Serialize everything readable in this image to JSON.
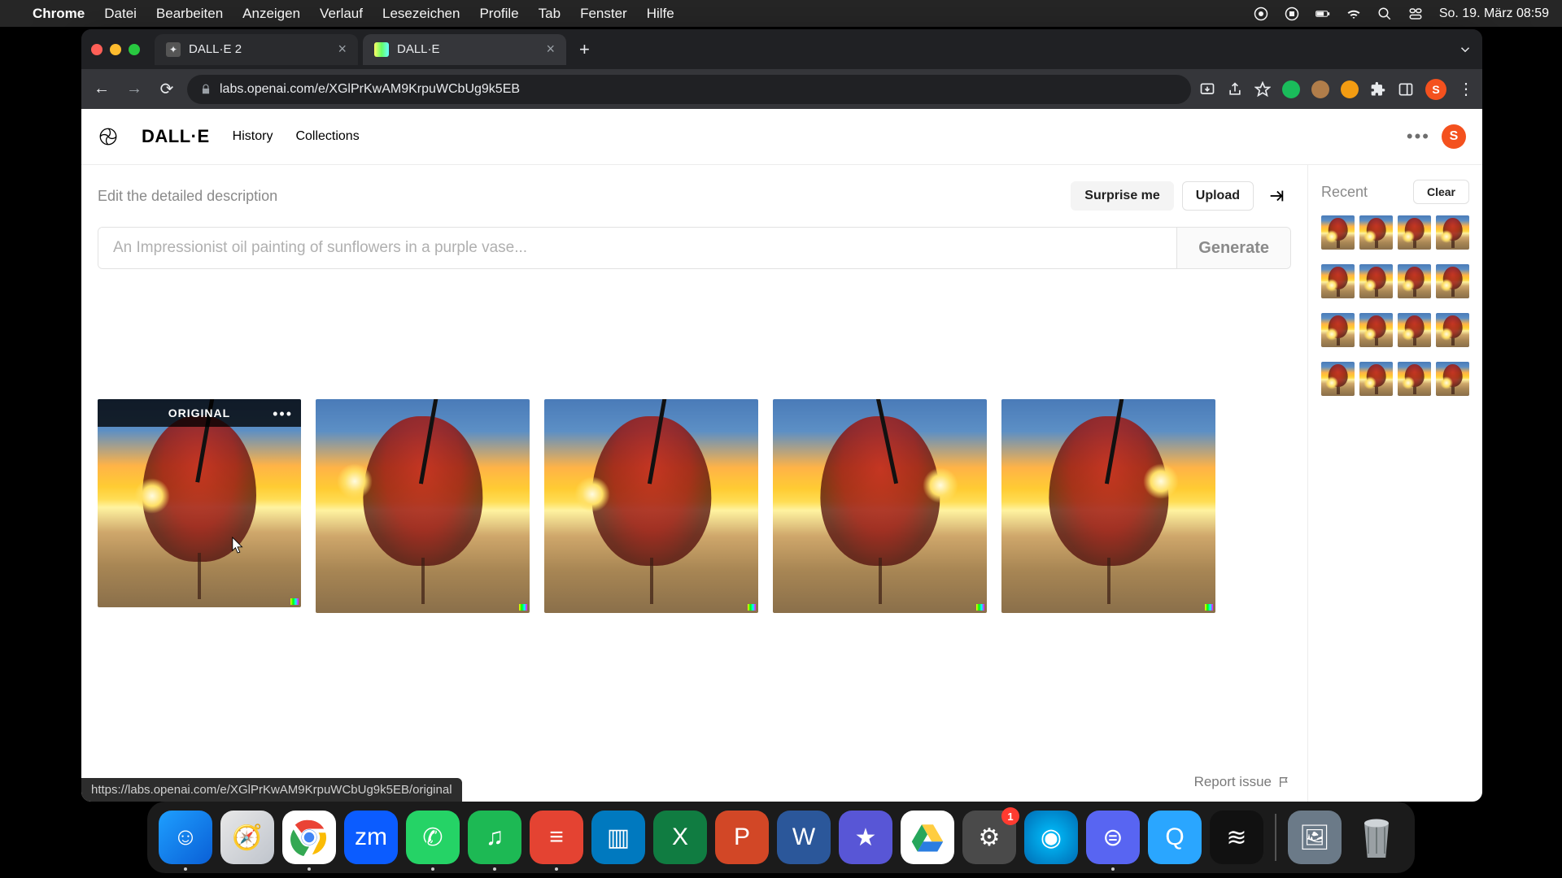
{
  "menubar": {
    "app": "Chrome",
    "items": [
      "Datei",
      "Bearbeiten",
      "Anzeigen",
      "Verlauf",
      "Lesezeichen",
      "Profile",
      "Tab",
      "Fenster",
      "Hilfe"
    ],
    "clock": "So. 19. März 08:59"
  },
  "browser": {
    "tabs": [
      {
        "title": "DALL·E 2",
        "active": false
      },
      {
        "title": "DALL·E",
        "active": true
      }
    ],
    "url": "labs.openai.com/e/XGlPrKwAM9KrpuWCbUg9k5EB",
    "avatar_initial": "S"
  },
  "app": {
    "brand": "DALL·E",
    "nav": {
      "history": "History",
      "collections": "Collections"
    },
    "user_initial": "S",
    "edit_label": "Edit the detailed description",
    "buttons": {
      "surprise": "Surprise me",
      "upload": "Upload",
      "generate": "Generate",
      "clear": "Clear"
    },
    "prompt_placeholder": "An Impressionist oil painting of sunflowers in a purple vase...",
    "original_badge": "ORIGINAL",
    "report_label": "Report issue",
    "status_url": "https://labs.openai.com/e/XGlPrKwAM9KrpuWCbUg9k5EB/original",
    "sidebar_title": "Recent",
    "settings_badge": "1"
  },
  "dock": {
    "apps": [
      {
        "name": "finder",
        "bg": "linear-gradient(135deg,#1e9fff,#0a5fd6)",
        "glyph": "☺",
        "running": true
      },
      {
        "name": "safari",
        "bg": "linear-gradient(135deg,#e8e8e8,#bfc4cc)",
        "glyph": "🧭",
        "running": false
      },
      {
        "name": "chrome",
        "bg": "#fff",
        "glyph": "",
        "running": true
      },
      {
        "name": "zoom",
        "bg": "#0b5cff",
        "glyph": "zm",
        "running": false
      },
      {
        "name": "whatsapp",
        "bg": "#25d366",
        "glyph": "✆",
        "running": true
      },
      {
        "name": "spotify",
        "bg": "#1db954",
        "glyph": "♫",
        "running": true
      },
      {
        "name": "todoist",
        "bg": "#e44332",
        "glyph": "≡",
        "running": true
      },
      {
        "name": "trello",
        "bg": "#0079bf",
        "glyph": "▥",
        "running": false
      },
      {
        "name": "excel",
        "bg": "#107c41",
        "glyph": "X",
        "running": false
      },
      {
        "name": "powerpoint",
        "bg": "#d24726",
        "glyph": "P",
        "running": false
      },
      {
        "name": "word",
        "bg": "#2b579a",
        "glyph": "W",
        "running": false
      },
      {
        "name": "imovie",
        "bg": "#5856d6",
        "glyph": "★",
        "running": false
      },
      {
        "name": "drive",
        "bg": "#fff",
        "glyph": "▲",
        "running": false
      },
      {
        "name": "settings",
        "bg": "#4a4a4a",
        "glyph": "⚙",
        "running": false,
        "badge": true
      },
      {
        "name": "siri",
        "bg": "radial-gradient(circle,#00c2ff,#006bb3)",
        "glyph": "◉",
        "running": false
      },
      {
        "name": "discord",
        "bg": "#5865f2",
        "glyph": "⊜",
        "running": true
      },
      {
        "name": "quicktime",
        "bg": "#2aa6ff",
        "glyph": "Q",
        "running": false
      },
      {
        "name": "voice",
        "bg": "#111",
        "glyph": "≋",
        "running": false
      }
    ]
  }
}
